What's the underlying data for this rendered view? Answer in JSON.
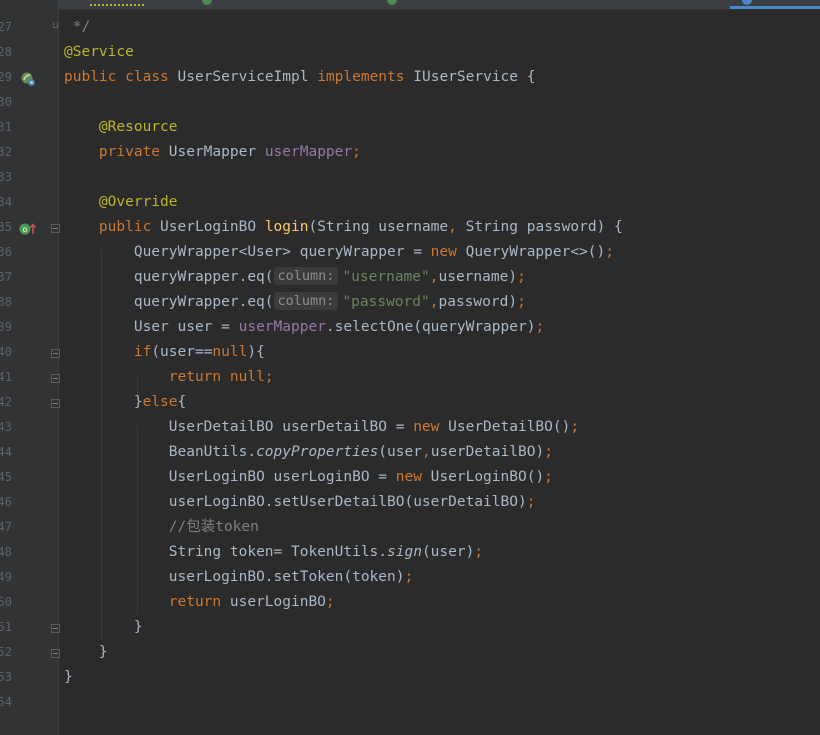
{
  "editor": {
    "line_numbers": [
      "27",
      "28",
      "29",
      "30",
      "31",
      "32",
      "33",
      "34",
      "35",
      "36",
      "37",
      "38",
      "39",
      "40",
      "41",
      "42",
      "43",
      "44",
      "45",
      "46",
      "47",
      "48",
      "49",
      "50",
      "51",
      "52",
      "53",
      "54"
    ],
    "inlay_hint_column": "column:",
    "code": {
      "l27": {
        "close": " */"
      },
      "l28": {
        "annotation": "@Service"
      },
      "l29": {
        "kw_public": "public",
        "kw_class": "class",
        "class_name": "UserServiceImpl",
        "kw_implements": "implements",
        "interface": "IUserService",
        "brace": "{"
      },
      "l31": {
        "annotation": "@Resource"
      },
      "l32": {
        "kw_private": "private",
        "type": "UserMapper",
        "field": "userMapper",
        "semi": ";"
      },
      "l34": {
        "annotation": "@Override"
      },
      "l35": {
        "kw_public": "public",
        "return_type": "UserLoginBO",
        "method": "login",
        "params_a": "(String username",
        "comma": ",",
        "params_b": " String password) {"
      },
      "l36": {
        "text_a": "QueryWrapper<User> queryWrapper = ",
        "kw_new": "new",
        "text_b": " QueryWrapper<>()",
        "semi": ";"
      },
      "l37": {
        "text_a": "queryWrapper.eq(",
        "str": "\"username\"",
        "comma": ",",
        "text_b": "username)",
        "semi": ";"
      },
      "l38": {
        "text_a": "queryWrapper.eq(",
        "str": "\"password\"",
        "comma": ",",
        "text_b": "password)",
        "semi": ";"
      },
      "l39": {
        "text_a": "User user = ",
        "field": "userMapper",
        "text_b": ".selectOne(queryWrapper)",
        "semi": ";"
      },
      "l40": {
        "kw_if": "if",
        "text_a": "(user==",
        "kw_null": "null",
        "text_b": "){"
      },
      "l41": {
        "kw_return": "return",
        "kw_null": "null",
        "semi": ";"
      },
      "l42": {
        "text_a": "}",
        "kw_else": "else",
        "text_b": "{"
      },
      "l43": {
        "text_a": "UserDetailBO userDetailBO = ",
        "kw_new": "new",
        "text_b": " UserDetailBO()",
        "semi": ";"
      },
      "l44": {
        "text_a": "BeanUtils.",
        "static_call": "copyProperties",
        "text_b": "(user",
        "comma": ",",
        "text_c": "userDetailBO)",
        "semi": ";"
      },
      "l45": {
        "text_a": "UserLoginBO userLoginBO = ",
        "kw_new": "new",
        "text_b": " UserLoginBO()",
        "semi": ";"
      },
      "l46": {
        "text_a": "userLoginBO.setUserDetailBO(userDetailBO)",
        "semi": ";"
      },
      "l47": {
        "comment": "//包装token"
      },
      "l48": {
        "text_a": "String token= TokenUtils.",
        "static_call": "sign",
        "text_b": "(user)",
        "semi": ";"
      },
      "l49": {
        "text_a": "userLoginBO.setToken(token)",
        "semi": ";"
      },
      "l50": {
        "kw_return": "return",
        "text_a": " userLoginBO",
        "semi": ";"
      },
      "l51": {
        "brace": "}"
      },
      "l52": {
        "brace": "}"
      },
      "l53": {
        "brace": "}"
      }
    }
  },
  "colors": {
    "background": "#2b2b2b",
    "gutter": "#313335",
    "keyword": "#cc7832",
    "annotation": "#bbb529",
    "field": "#9876aa",
    "string": "#6a8759",
    "comment": "#808080",
    "method_decl": "#ffc66d",
    "default_text": "#a9b7c6"
  },
  "icons": {
    "run_gutter": "spring-bean-icon",
    "implements_gutter": "override-marker-icon"
  }
}
